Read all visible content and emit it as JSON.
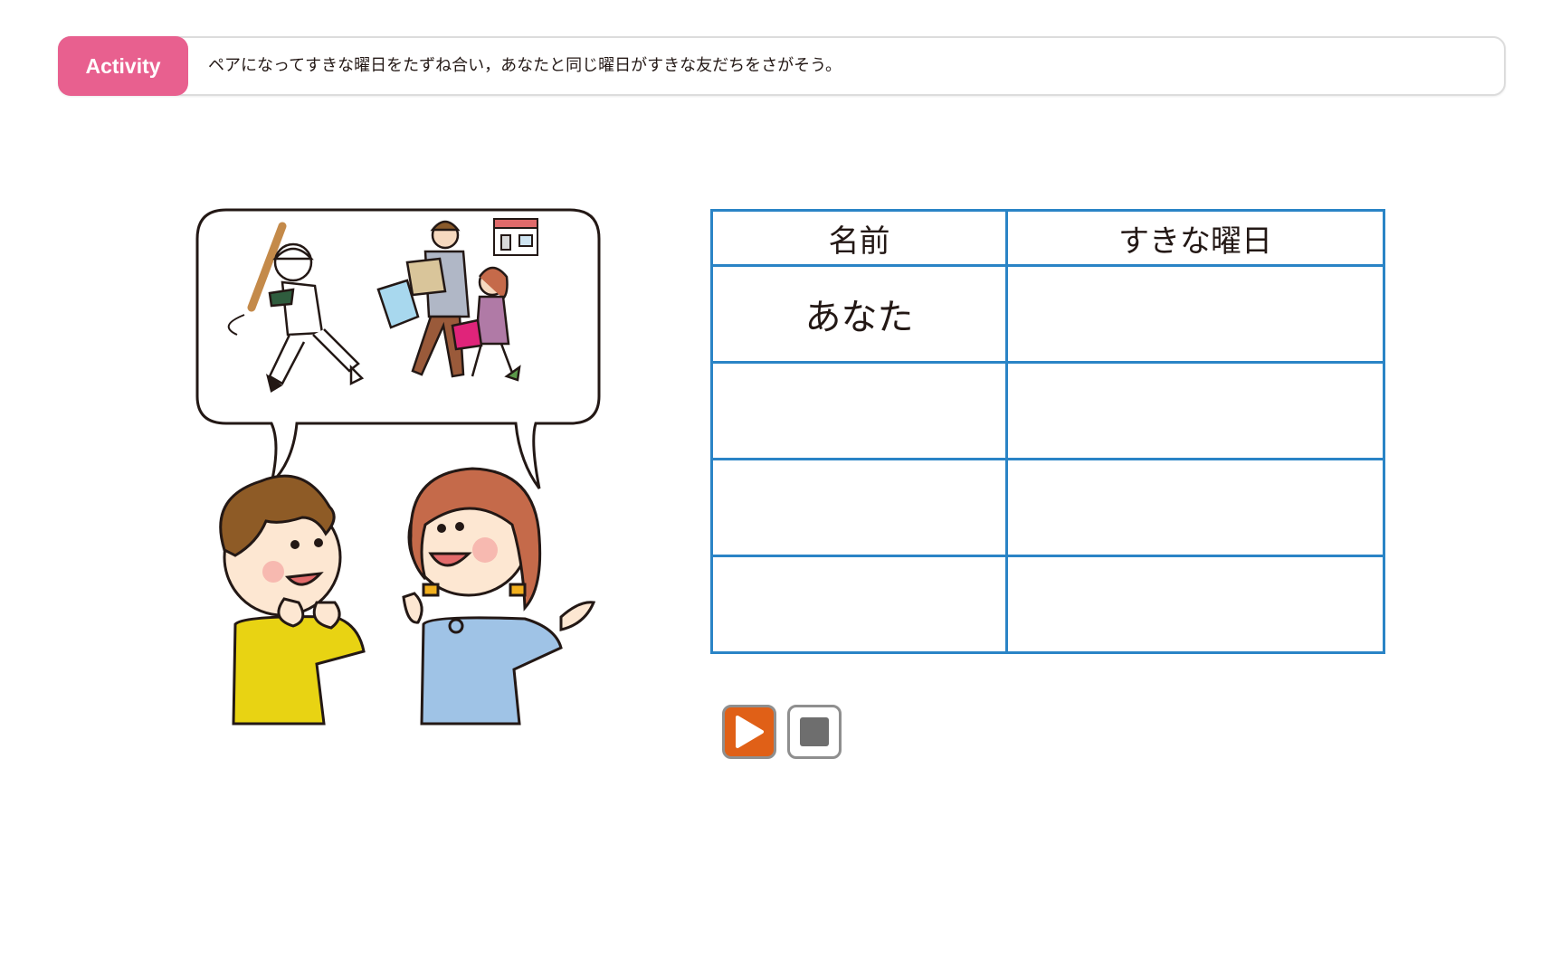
{
  "header": {
    "badge_label": "Activity",
    "instruction": "ペアになってすきな曜日をたずね合い，あなたと同じ曜日がすきな友だちをさがそう。"
  },
  "illustration": {
    "icons": [
      "speech-bubble-icon",
      "baseball-player-icon",
      "shopping-family-icon",
      "shop-icon",
      "boy-icon",
      "girl-icon"
    ]
  },
  "table": {
    "headers": [
      "名前",
      "すきな曜日"
    ],
    "rows": [
      [
        "あなた",
        ""
      ],
      [
        "",
        ""
      ],
      [
        "",
        ""
      ],
      [
        "",
        ""
      ]
    ]
  },
  "controls": {
    "play_icon": "play-icon",
    "stop_icon": "stop-icon"
  },
  "colors": {
    "badge": "#e8608f",
    "table_border": "#2a84c6",
    "play_button": "#e06017",
    "stop_square": "#6e6e6e"
  }
}
